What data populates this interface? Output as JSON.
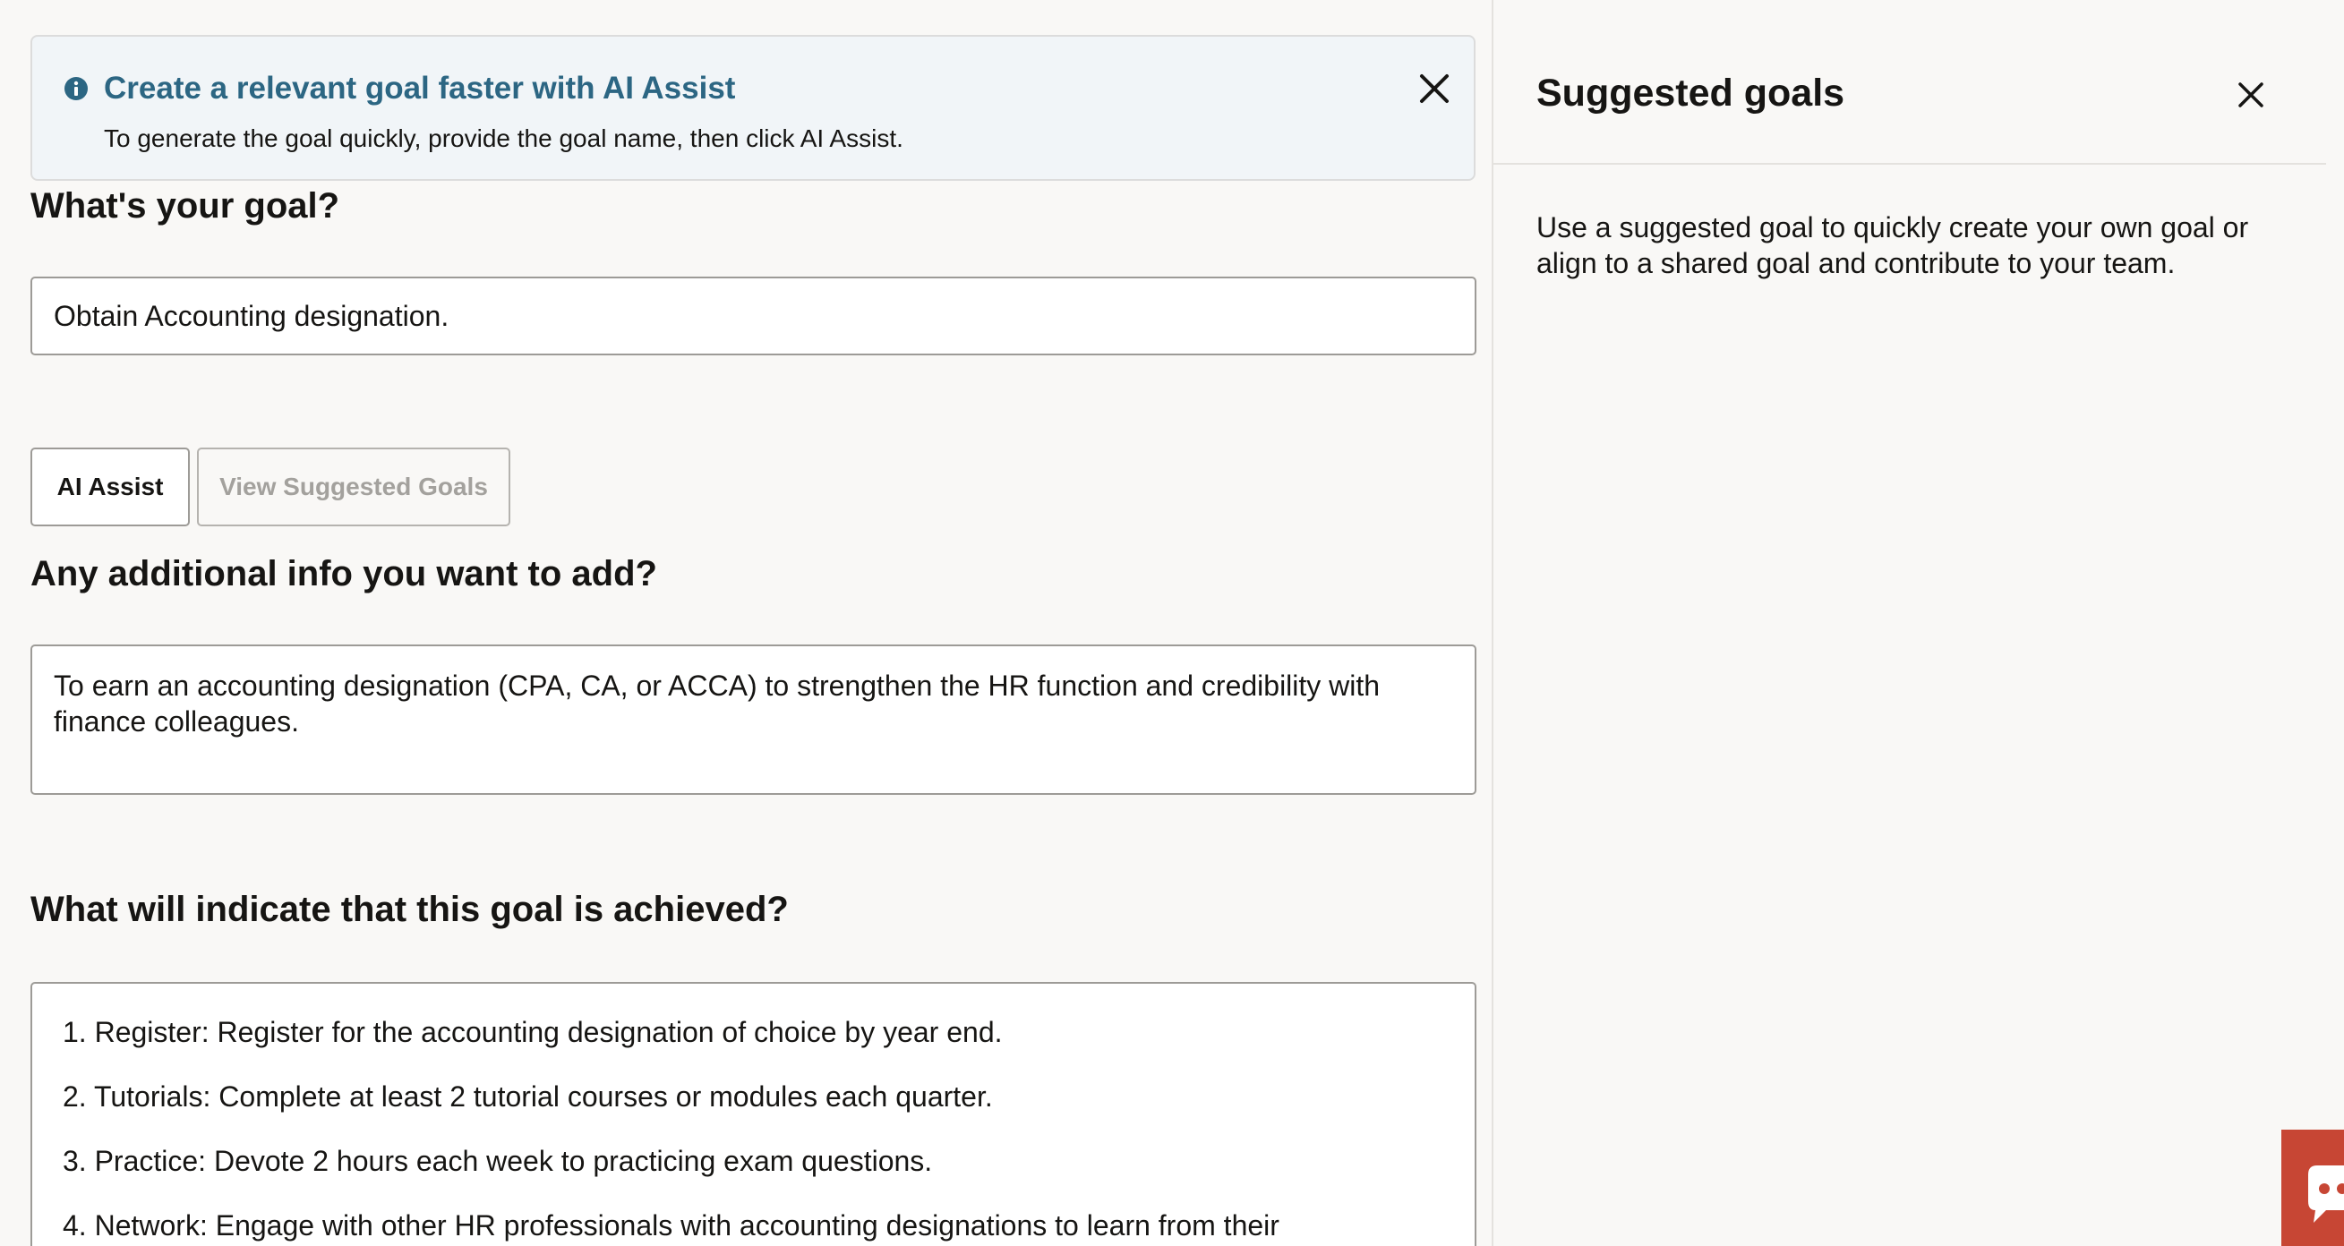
{
  "banner": {
    "title": "Create a relevant goal faster with AI Assist",
    "text": "To generate the goal quickly, provide the goal name, then click AI Assist.",
    "icon": "info-icon",
    "close_icon": "close-icon"
  },
  "goal_section": {
    "heading": "What's your goal?",
    "value": "Obtain Accounting designation."
  },
  "actions": {
    "ai_assist_label": "AI Assist",
    "view_suggested_label": "View Suggested Goals"
  },
  "info_section": {
    "heading": "Any additional info you want to add?",
    "value": "To earn an accounting designation (CPA, CA, or ACCA) to strengthen the HR function and credibility with finance colleagues."
  },
  "achieved_section": {
    "heading": "What will indicate that this goal is achieved?",
    "items": [
      "1. Register: Register for the accounting designation of choice by year end.",
      "2. Tutorials: Complete at least 2 tutorial courses or modules each quarter.",
      "3. Practice: Devote 2 hours each week to practicing exam questions.",
      "4. Network: Engage with other HR professionals with accounting designations to learn from their"
    ]
  },
  "panel": {
    "title": "Suggested goals",
    "description": "Use a suggested goal to quickly create your own goal or align to a shared goal and contribute to your team.",
    "close_icon": "close-icon"
  },
  "colors": {
    "banner_title": "#2c6683",
    "banner_bg": "#f1f5f8",
    "page_bg": "#f9f8f6",
    "chat_widget": "#c74634"
  }
}
